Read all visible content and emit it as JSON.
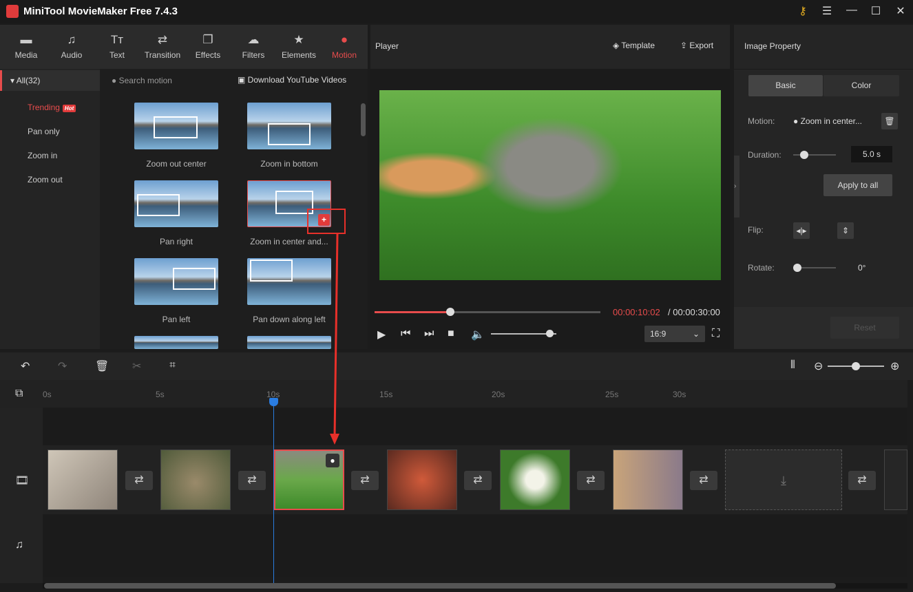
{
  "app": {
    "title": "MiniTool MovieMaker Free 7.4.3"
  },
  "toolbar": {
    "tabs": [
      {
        "label": "Media",
        "icon": "folder-icon",
        "glyph": "▬"
      },
      {
        "label": "Audio",
        "icon": "music-icon",
        "glyph": "♫"
      },
      {
        "label": "Text",
        "icon": "text-icon",
        "glyph": "Tт"
      },
      {
        "label": "Transition",
        "icon": "transition-icon",
        "glyph": "⇄"
      },
      {
        "label": "Effects",
        "icon": "effects-icon",
        "glyph": "❐"
      },
      {
        "label": "Filters",
        "icon": "filters-icon",
        "glyph": "☁"
      },
      {
        "label": "Elements",
        "icon": "elements-icon",
        "glyph": "★"
      },
      {
        "label": "Motion",
        "icon": "motion-icon",
        "glyph": "●"
      }
    ],
    "active": "Motion"
  },
  "sidebar": {
    "all": "All(32)",
    "items": [
      {
        "label": "Trending",
        "badge": "Hot"
      },
      {
        "label": "Pan only"
      },
      {
        "label": "Zoom in"
      },
      {
        "label": "Zoom out"
      }
    ]
  },
  "motion": {
    "search_placeholder": "Search motion",
    "download": "Download YouTube Videos",
    "items": [
      "Zoom out center",
      "Zoom in bottom",
      "Pan right",
      "Zoom in center and...",
      "Pan left",
      "Pan down along left"
    ]
  },
  "player": {
    "title": "Player",
    "template": "Template",
    "export": "Export",
    "current_time": "00:00:10:02",
    "total_time": "/ 00:00:30:00",
    "progress": 0.334,
    "volume": 0.9,
    "aspect": "16:9"
  },
  "property": {
    "title": "Image Property",
    "tabs": [
      "Basic",
      "Color"
    ],
    "motion_label": "Motion:",
    "motion_value": "Zoom in center...",
    "duration_label": "Duration:",
    "duration_value": "5.0 s",
    "apply_all": "Apply to all",
    "flip_label": "Flip:",
    "rotate_label": "Rotate:",
    "rotate_value": "0°",
    "reset": "Reset"
  },
  "timeline": {
    "ticks": [
      "0s",
      "5s",
      "10s",
      "15s",
      "20s",
      "25s",
      "30s"
    ],
    "playhead_time": "10s",
    "zoom": 0.5
  }
}
